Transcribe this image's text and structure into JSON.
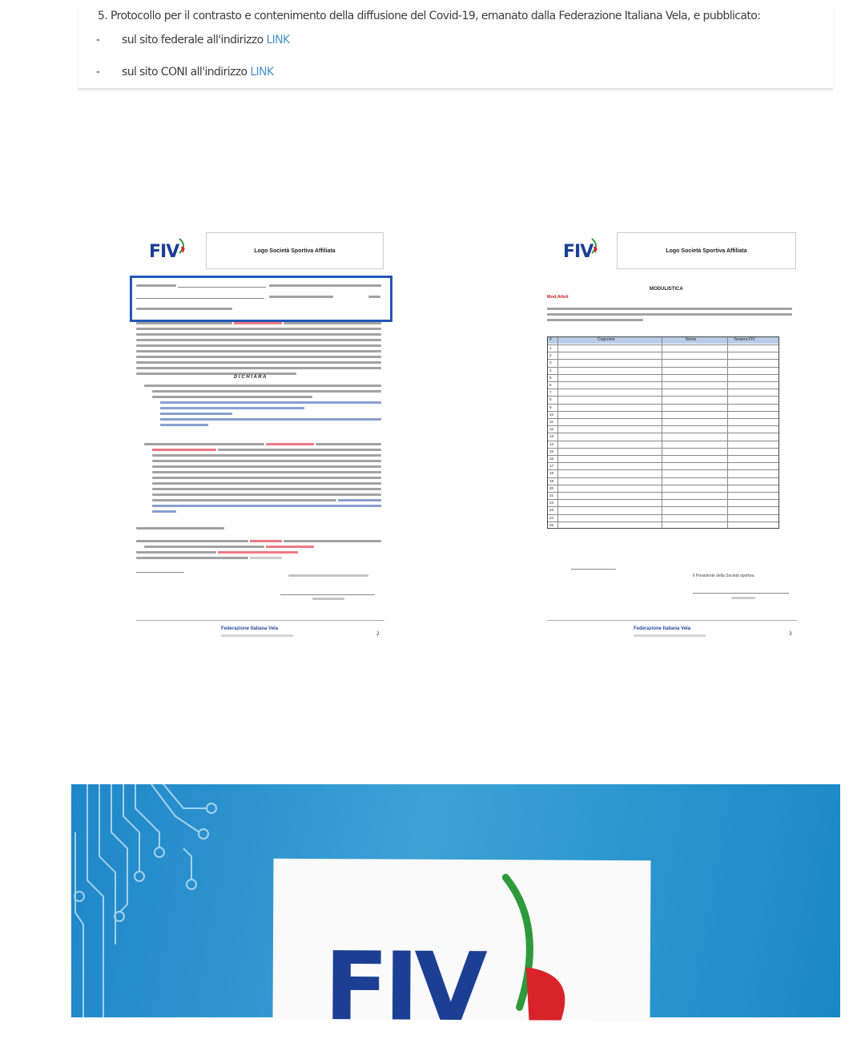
{
  "top_panel": {
    "item5": "5.  Protocollo per il contrasto e contenimento della diffusione del Covid-19, emanato dalla Federazione Italiana Vela, e pubblicato:",
    "bullet1_prefix": "sul sito federale all'indirizzo",
    "bullet2_prefix": "sul sito CONI all'indirizzo",
    "link_text": "LINK",
    "dash": "-"
  },
  "page1": {
    "logo": "FIV",
    "logo_box": "Logo Società Sportiva Affiliata",
    "dichiara": "D I C H I A R A",
    "footer": "Federazione Italiana Vela",
    "page_number": "2"
  },
  "page2": {
    "logo": "FIV",
    "logo_box": "Logo Società Sportiva Affiliata",
    "title": "MODULISTICA",
    "subtitle": "Mod.Atleti",
    "columns": [
      "#",
      "Cognome",
      "Nome",
      "Tessera FIV"
    ],
    "rows": [
      "1",
      "2",
      "3",
      "4",
      "5",
      "6",
      "7",
      "8",
      "9",
      "10",
      "11",
      "12",
      "13",
      "14",
      "15",
      "16",
      "17",
      "18",
      "19",
      "20",
      "21",
      "22",
      "23",
      "24",
      "25"
    ],
    "signature": "Il Presidente della Società sportiva",
    "footer": "Federazione Italiana Vela",
    "page_number": "3"
  },
  "banner": {
    "logo": "FIV"
  },
  "colors": {
    "link": "#4a90c8",
    "fiv_blue": "#1c3f94",
    "banner_blue": "#2a98d2",
    "table_header": "#b9cbe8"
  }
}
